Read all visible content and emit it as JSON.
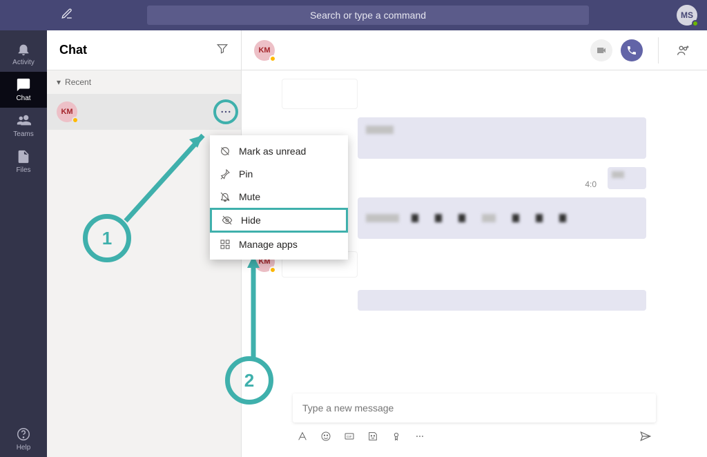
{
  "search_placeholder": "Search or type a command",
  "user_initials": "MS",
  "rail": {
    "activity": "Activity",
    "chat": "Chat",
    "teams": "Teams",
    "files": "Files",
    "help": "Help"
  },
  "sidebar": {
    "title": "Chat",
    "section": "Recent",
    "chat_items": [
      {
        "initials": "KM"
      }
    ]
  },
  "context_menu": {
    "mark_unread": "Mark as unread",
    "pin": "Pin",
    "mute": "Mute",
    "hide": "Hide",
    "manage_apps": "Manage apps"
  },
  "conversation": {
    "header_initials": "KM",
    "timestamp": "4:0",
    "msg2_initials": "KM"
  },
  "composer": {
    "placeholder": "Type a new message"
  },
  "annotations": {
    "step1": "1",
    "step2": "2"
  },
  "colors": {
    "teal": "#3fb0ac",
    "purple": "#6264a7"
  }
}
